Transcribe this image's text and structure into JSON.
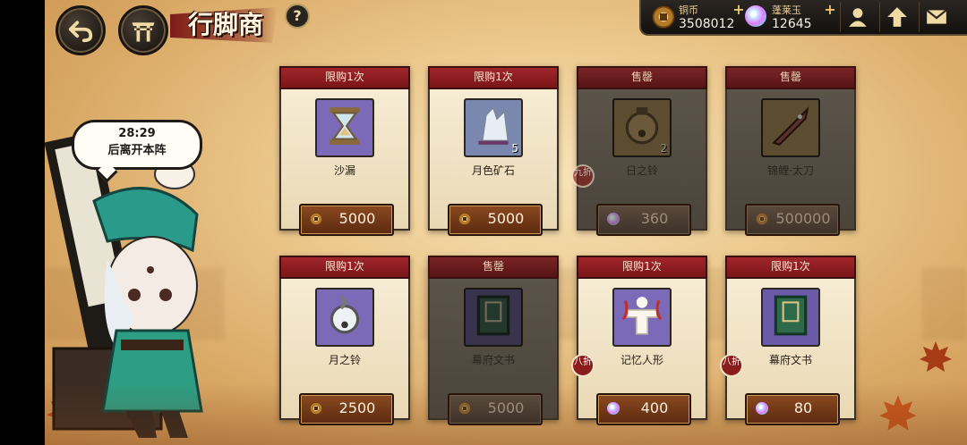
{
  "header": {
    "title": "行脚商",
    "help": "?"
  },
  "currencies": [
    {
      "name": "铜币",
      "value": "3508012",
      "icon": "copper-coin-icon"
    },
    {
      "name": "蓬莱玉",
      "value": "12645",
      "icon": "jade-icon"
    }
  ],
  "top_buttons": [
    "friend-icon",
    "upgrade-icon",
    "mail-icon"
  ],
  "merchant": {
    "timer": "28:29",
    "timer_text": "后离开本阵"
  },
  "shop": {
    "items": [
      {
        "badge": "限购1次",
        "name": "沙漏",
        "price": "5000",
        "currency": "copper",
        "qty": "",
        "discount": "",
        "sold_out": false,
        "icon": "hourglass-icon"
      },
      {
        "badge": "限购1次",
        "name": "月色矿石",
        "price": "5000",
        "currency": "copper",
        "qty": "5",
        "discount": "",
        "sold_out": false,
        "icon": "crystal-icon"
      },
      {
        "badge": "售罄",
        "name": "日之铃",
        "price": "360",
        "currency": "jade",
        "qty": "2",
        "discount": "九折",
        "sold_out": true,
        "icon": "sun-bell-icon"
      },
      {
        "badge": "售罄",
        "name": "锦鲤·太刀",
        "price": "500000",
        "currency": "copper",
        "qty": "",
        "discount": "",
        "sold_out": true,
        "icon": "koi-sword-icon"
      },
      {
        "badge": "限购1次",
        "name": "月之铃",
        "price": "2500",
        "currency": "copper",
        "qty": "",
        "discount": "",
        "sold_out": false,
        "icon": "moon-bell-icon"
      },
      {
        "badge": "售罄",
        "name": "幕府文书",
        "price": "5000",
        "currency": "copper",
        "qty": "",
        "discount": "",
        "sold_out": true,
        "icon": "document-book-icon"
      },
      {
        "badge": "限购1次",
        "name": "记忆人形",
        "price": "400",
        "currency": "jade",
        "qty": "",
        "discount": "八折",
        "sold_out": false,
        "icon": "paper-doll-icon"
      },
      {
        "badge": "限购1次",
        "name": "幕府文书",
        "price": "80",
        "currency": "jade",
        "qty": "",
        "discount": "八折",
        "sold_out": false,
        "icon": "document-book-icon"
      }
    ]
  }
}
